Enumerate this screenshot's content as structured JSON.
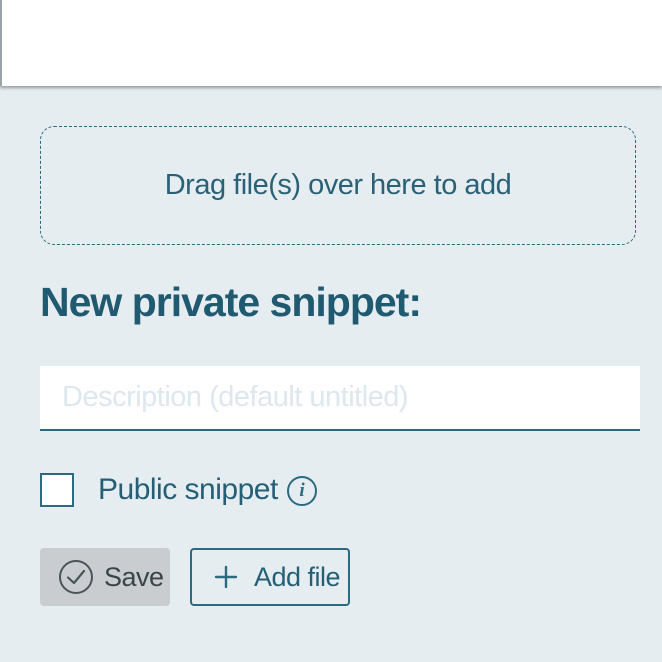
{
  "dropzone": {
    "text": "Drag file(s) over here to add"
  },
  "form": {
    "title": "New private snippet:",
    "description_placeholder": "Description (default untitled)",
    "description_value": "",
    "public_label": "Public snippet",
    "public_checked": false,
    "info_icon": "info-icon"
  },
  "actions": {
    "save_label": "Save",
    "save_icon": "check-circle-icon",
    "add_file_label": "Add file",
    "add_file_icon": "plus-icon"
  },
  "colors": {
    "background": "#e6edf1",
    "accent": "#2c6a80",
    "title": "#1f5a70",
    "disabled_button": "#c9cdcf"
  }
}
